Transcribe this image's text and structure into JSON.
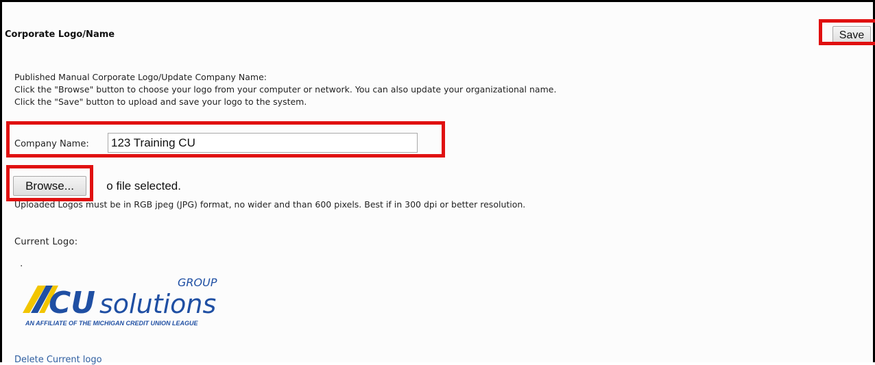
{
  "panel": {
    "title": "Corporate Logo/Name",
    "save_label": "Save"
  },
  "instructions": [
    "Published Manual Corporate Logo/Update Company Name:",
    "Click the \"Browse\" button to choose your logo from your computer or network. You can also update your organizational name.",
    "Click the \"Save\" button to upload and save your logo to the system."
  ],
  "company": {
    "label": "Company Name:",
    "value": "123 Training CU"
  },
  "upload": {
    "browse_label": "Browse...",
    "status": "No file selected.",
    "requirements": "Uploaded Logos must be in RGB jpeg (JPG) format, no wider and than 600 pixels. Best if in 300 dpi or better resolution."
  },
  "current_logo": {
    "label": "Current Logo:",
    "dot": ".",
    "logo_group": "GROUP",
    "logo_cu": "CU",
    "logo_solutions": "solutions",
    "logo_tagline": "AN AFFILIATE OF THE MICHIGAN CREDIT UNION LEAGUE"
  },
  "delete_link": "Delete Current logo",
  "colors": {
    "highlight": "#e01010",
    "logo_blue": "#1f4fa3",
    "logo_yellow": "#f2c500",
    "link": "#2e5ea0"
  }
}
